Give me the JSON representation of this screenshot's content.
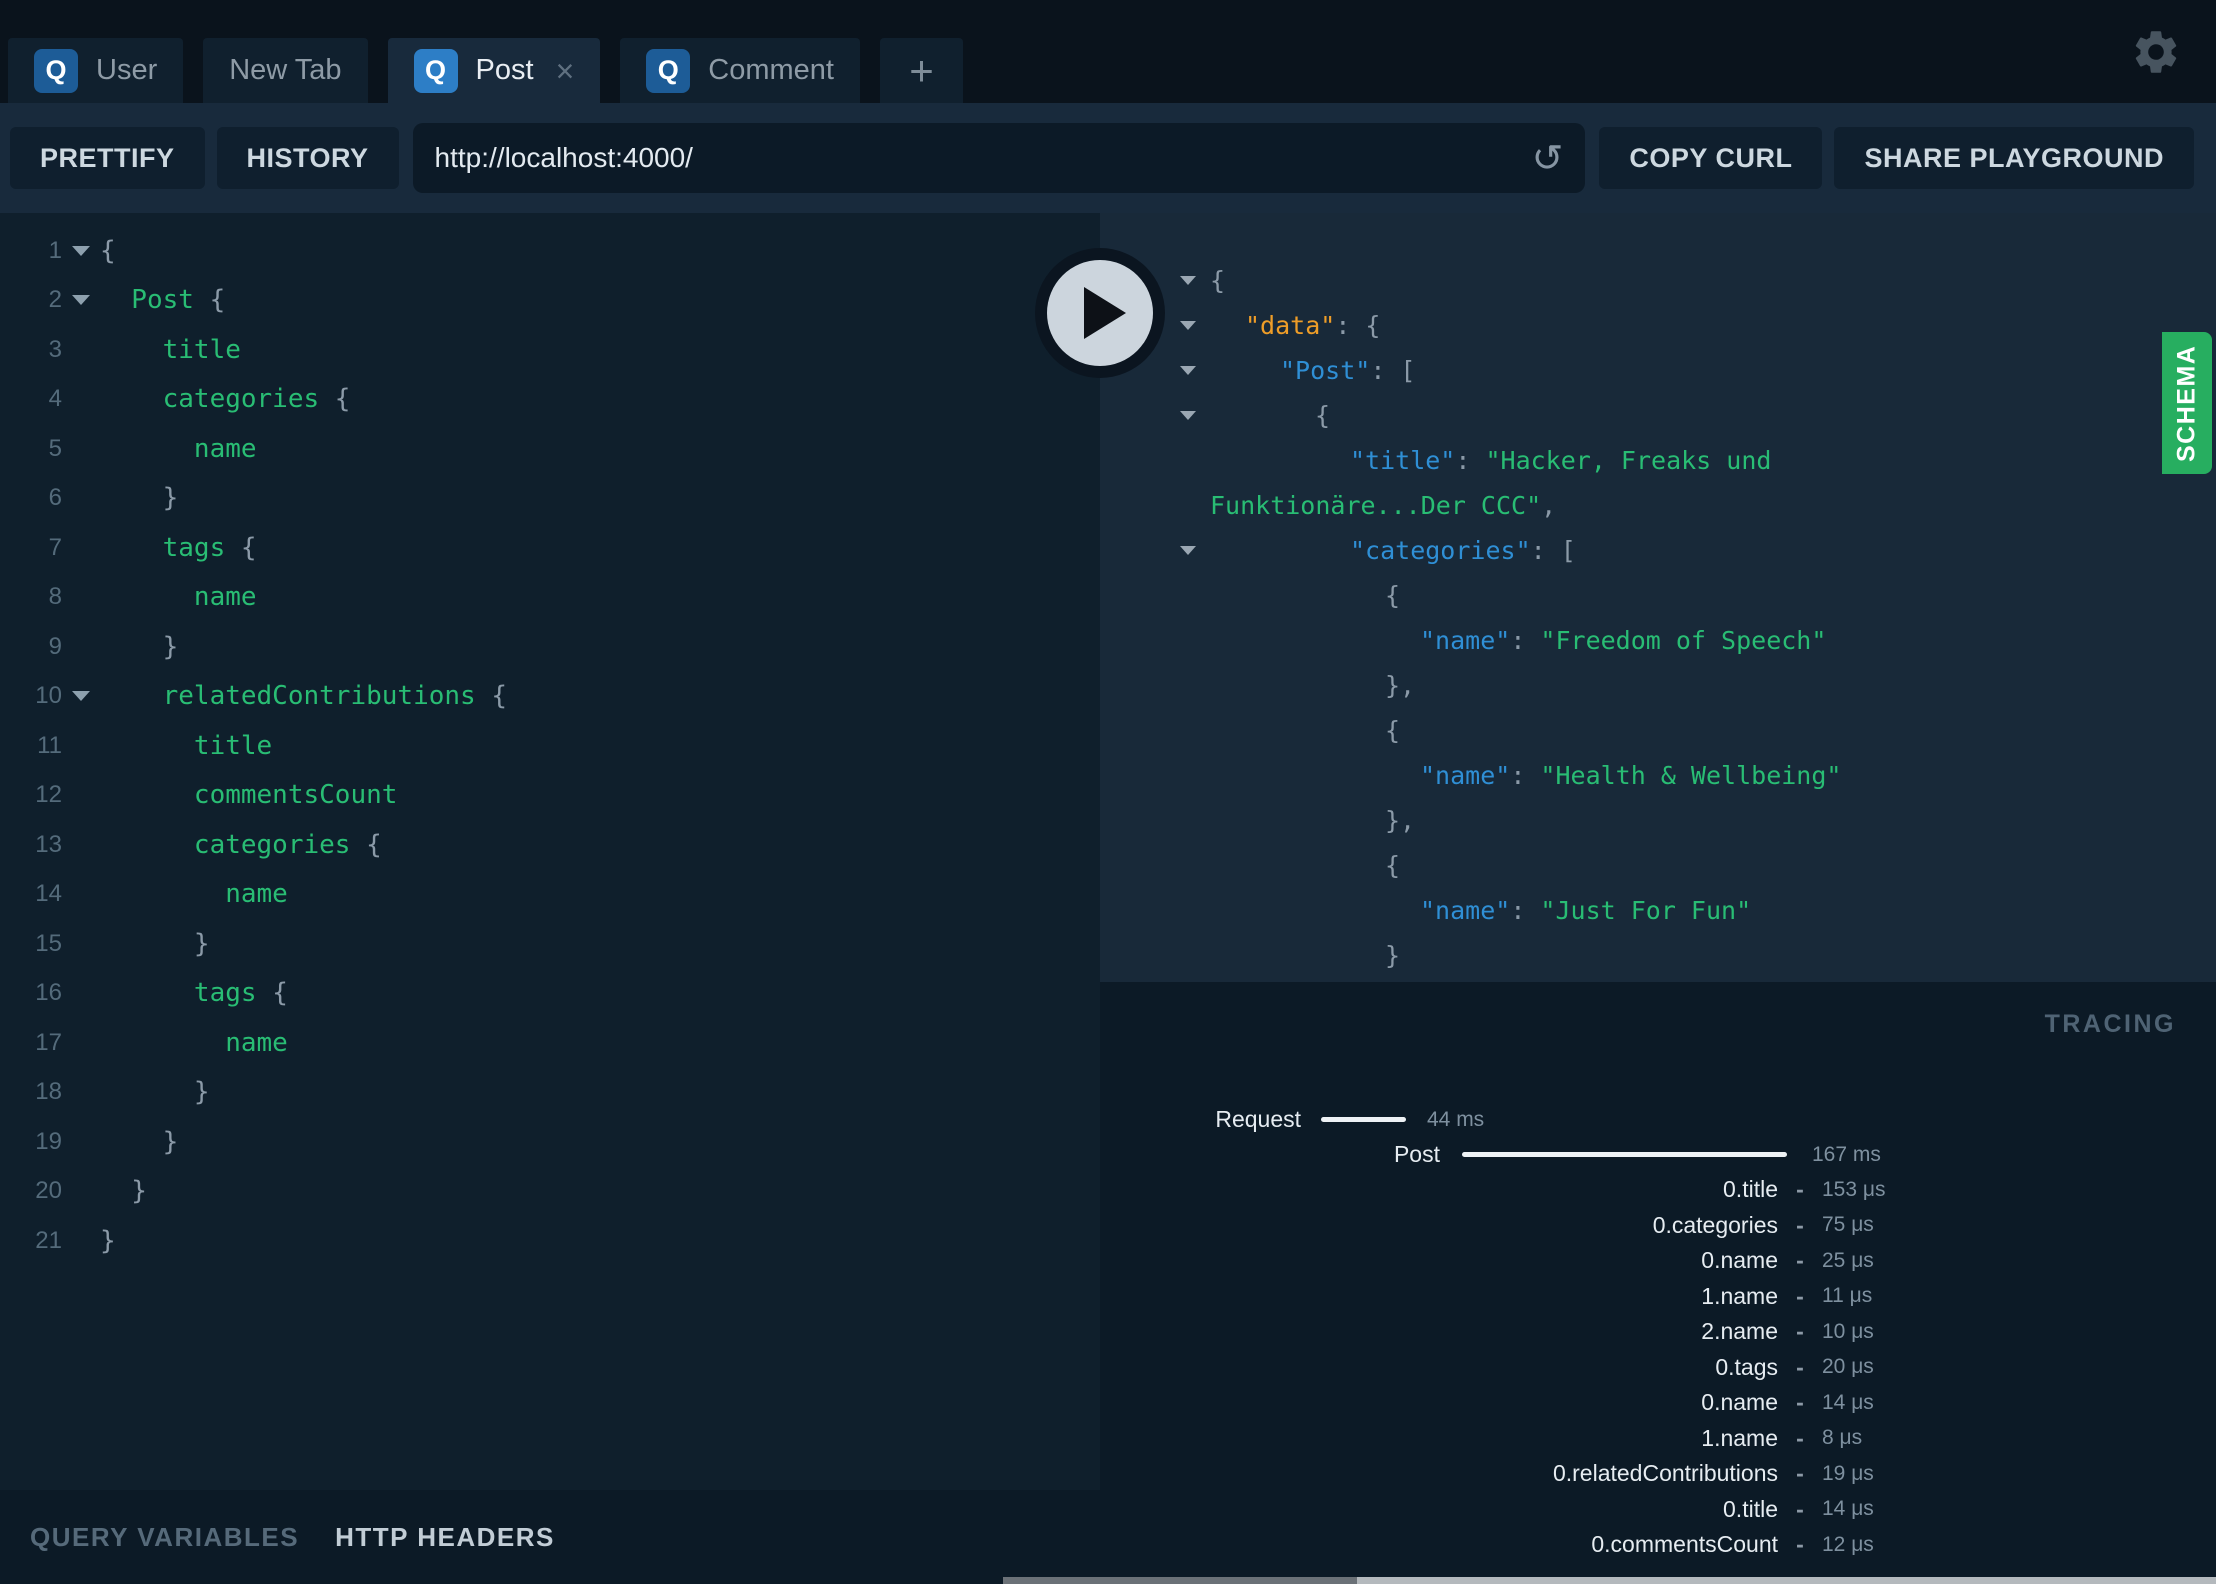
{
  "topbar": {
    "tabs": [
      {
        "label": "User",
        "badge": "Q",
        "active": false,
        "closable": false
      },
      {
        "label": "New Tab",
        "badge": "",
        "active": false,
        "closable": false
      },
      {
        "label": "Post",
        "badge": "Q",
        "active": true,
        "closable": true
      },
      {
        "label": "Comment",
        "badge": "Q",
        "active": false,
        "closable": false
      }
    ],
    "plus_label": "+",
    "close_label": "×"
  },
  "toolbar": {
    "prettify": "PRETTIFY",
    "history": "HISTORY",
    "url": "http://localhost:4000/",
    "reload_icon": "↺",
    "copy_curl": "COPY CURL",
    "share": "SHARE PLAYGROUND"
  },
  "editor": {
    "lines": [
      {
        "n": 1,
        "fold": true,
        "code": [
          [
            "p",
            "{"
          ]
        ]
      },
      {
        "n": 2,
        "fold": true,
        "code": [
          [
            "f",
            "  Post"
          ],
          [
            "p",
            " {"
          ]
        ]
      },
      {
        "n": 3,
        "fold": false,
        "code": [
          [
            "f",
            "    title"
          ]
        ]
      },
      {
        "n": 4,
        "fold": false,
        "code": [
          [
            "f",
            "    categories"
          ],
          [
            "p",
            " {"
          ]
        ]
      },
      {
        "n": 5,
        "fold": false,
        "code": [
          [
            "f",
            "      name"
          ]
        ]
      },
      {
        "n": 6,
        "fold": false,
        "code": [
          [
            "p",
            "    }"
          ]
        ]
      },
      {
        "n": 7,
        "fold": false,
        "code": [
          [
            "f",
            "    tags"
          ],
          [
            "p",
            " {"
          ]
        ]
      },
      {
        "n": 8,
        "fold": false,
        "code": [
          [
            "f",
            "      name"
          ]
        ]
      },
      {
        "n": 9,
        "fold": false,
        "code": [
          [
            "p",
            "    }"
          ]
        ]
      },
      {
        "n": 10,
        "fold": true,
        "code": [
          [
            "f",
            "    relatedContributions"
          ],
          [
            "p",
            " {"
          ]
        ]
      },
      {
        "n": 11,
        "fold": false,
        "code": [
          [
            "f",
            "      title"
          ]
        ]
      },
      {
        "n": 12,
        "fold": false,
        "code": [
          [
            "f",
            "      commentsCount"
          ]
        ]
      },
      {
        "n": 13,
        "fold": false,
        "code": [
          [
            "f",
            "      categories"
          ],
          [
            "p",
            " {"
          ]
        ]
      },
      {
        "n": 14,
        "fold": false,
        "code": [
          [
            "f",
            "        name"
          ]
        ]
      },
      {
        "n": 15,
        "fold": false,
        "code": [
          [
            "p",
            "      }"
          ]
        ]
      },
      {
        "n": 16,
        "fold": false,
        "code": [
          [
            "f",
            "      tags"
          ],
          [
            "p",
            " {"
          ]
        ]
      },
      {
        "n": 17,
        "fold": false,
        "code": [
          [
            "f",
            "        name"
          ]
        ]
      },
      {
        "n": 18,
        "fold": false,
        "code": [
          [
            "p",
            "      }"
          ]
        ]
      },
      {
        "n": 19,
        "fold": false,
        "code": [
          [
            "p",
            "    }"
          ]
        ]
      },
      {
        "n": 20,
        "fold": false,
        "code": [
          [
            "p",
            "  }"
          ]
        ]
      },
      {
        "n": 21,
        "fold": false,
        "code": [
          [
            "p",
            "}"
          ]
        ]
      }
    ]
  },
  "response": {
    "lines": [
      {
        "fold": true,
        "d": 0,
        "code": [
          [
            "p",
            "{"
          ]
        ]
      },
      {
        "fold": true,
        "d": 1,
        "code": [
          [
            "o",
            "\"data\""
          ],
          [
            "p",
            ": {"
          ]
        ]
      },
      {
        "fold": true,
        "d": 2,
        "code": [
          [
            "k",
            "\"Post\""
          ],
          [
            "p",
            ": ["
          ]
        ]
      },
      {
        "fold": true,
        "d": 3,
        "code": [
          [
            "p",
            "{"
          ]
        ]
      },
      {
        "fold": false,
        "d": 4,
        "code": [
          [
            "k",
            "\"title\""
          ],
          [
            "p",
            ": "
          ],
          [
            "s",
            "\"Hacker, Freaks und"
          ]
        ]
      },
      {
        "fold": false,
        "d": 0,
        "code": [
          [
            "s",
            "Funktionäre...Der CCC\""
          ],
          [
            "p",
            ","
          ]
        ]
      },
      {
        "fold": true,
        "d": 4,
        "code": [
          [
            "k",
            "\"categories\""
          ],
          [
            "p",
            ": ["
          ]
        ]
      },
      {
        "fold": false,
        "d": 5,
        "code": [
          [
            "p",
            "{"
          ]
        ]
      },
      {
        "fold": false,
        "d": 6,
        "code": [
          [
            "k",
            "\"name\""
          ],
          [
            "p",
            ": "
          ],
          [
            "s",
            "\"Freedom of Speech\""
          ]
        ]
      },
      {
        "fold": false,
        "d": 5,
        "code": [
          [
            "p",
            "},"
          ]
        ]
      },
      {
        "fold": false,
        "d": 5,
        "code": [
          [
            "p",
            "{"
          ]
        ]
      },
      {
        "fold": false,
        "d": 6,
        "code": [
          [
            "k",
            "\"name\""
          ],
          [
            "p",
            ": "
          ],
          [
            "s",
            "\"Health & Wellbeing\""
          ]
        ]
      },
      {
        "fold": false,
        "d": 5,
        "code": [
          [
            "p",
            "},"
          ]
        ]
      },
      {
        "fold": false,
        "d": 5,
        "code": [
          [
            "p",
            "{"
          ]
        ]
      },
      {
        "fold": false,
        "d": 6,
        "code": [
          [
            "k",
            "\"name\""
          ],
          [
            "p",
            ": "
          ],
          [
            "s",
            "\"Just For Fun\""
          ]
        ]
      },
      {
        "fold": false,
        "d": 5,
        "code": [
          [
            "p",
            "}"
          ]
        ]
      },
      {
        "fold": false,
        "d": 4,
        "code": [
          [
            "p",
            "]"
          ]
        ]
      }
    ]
  },
  "schema_tab": "SCHEMA",
  "tracing": {
    "title": "TRACING",
    "request": {
      "label": "Request",
      "value": "44 ms"
    },
    "post": {
      "label": "Post",
      "value": "167 ms"
    },
    "rows": [
      {
        "label": "0.title",
        "value": "153 μs"
      },
      {
        "label": "0.categories",
        "value": "75 μs"
      },
      {
        "label": "0.name",
        "value": "25 μs"
      },
      {
        "label": "1.name",
        "value": "11 μs"
      },
      {
        "label": "2.name",
        "value": "10 μs"
      },
      {
        "label": "0.tags",
        "value": "20 μs"
      },
      {
        "label": "0.name",
        "value": "14 μs"
      },
      {
        "label": "1.name",
        "value": "8 μs"
      },
      {
        "label": "0.relatedContributions",
        "value": "19 μs"
      },
      {
        "label": "0.title",
        "value": "14 μs"
      },
      {
        "label": "0.commentsCount",
        "value": "12 μs"
      }
    ],
    "dash": "-"
  },
  "bottom_tabs": {
    "query_variables": "QUERY VARIABLES",
    "http_headers": "HTTP HEADERS"
  },
  "colors": {
    "schema_green": "#27ae60",
    "field_green": "#29bd74",
    "key_blue": "#2f8fd5",
    "data_orange": "#ee9d28",
    "active_tab_badge_blue": "#2d7ec6"
  }
}
